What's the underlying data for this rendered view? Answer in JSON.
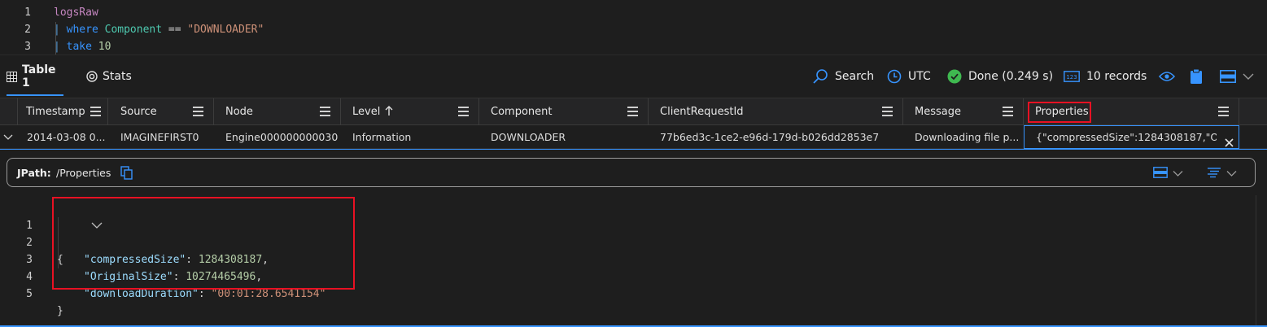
{
  "editor": {
    "lines": [
      {
        "num": "1",
        "table": "logsRaw"
      },
      {
        "num": "2",
        "pipe": "|",
        "keyword": "where",
        "column": "Component",
        "operator": "==",
        "string": "\"DOWNLOADER\""
      },
      {
        "num": "3",
        "pipe": "|",
        "keyword": "take",
        "number": "10"
      }
    ]
  },
  "toolbar": {
    "tabs": [
      {
        "label": "Table 1",
        "icon": "table-icon",
        "active": true
      },
      {
        "label": "Stats",
        "icon": "stats-icon",
        "active": false
      }
    ],
    "search_label": "Search",
    "timezone_label": "UTC",
    "status_label": "Done (0.249 s)",
    "records_label": "10 records",
    "icons": [
      "search-icon",
      "clock-icon",
      "check-circle-icon",
      "records-icon",
      "eye-icon",
      "clipboard-icon",
      "layout-icon",
      "chevron-down-icon"
    ]
  },
  "grid": {
    "columns": [
      {
        "label": "Timestamp"
      },
      {
        "label": "Source"
      },
      {
        "label": "Node"
      },
      {
        "label": "Level",
        "sort": "ascending"
      },
      {
        "label": "Component"
      },
      {
        "label": "ClientRequestId"
      },
      {
        "label": "Message"
      },
      {
        "label": "Properties",
        "highlighted": true
      }
    ],
    "rows": [
      {
        "Timestamp": "2014-03-08 0...",
        "Source": "IMAGINEFIRST0",
        "Node": "Engine000000000030",
        "Level": "Information",
        "Component": "DOWNLOADER",
        "ClientRequestId": "77b6ed3c-1ce2-e96d-179d-b026dd2853e7",
        "Message": "Downloading file p...",
        "Properties": "{\"compressedSize\":1284308187,\"Ori..."
      }
    ]
  },
  "detail": {
    "jpath_label": "JPath:",
    "jpath_value": "/Properties",
    "json_lines": [
      {
        "num": "1",
        "text": "{"
      },
      {
        "num": "2",
        "key": "\"compressedSize\"",
        "sep": ": ",
        "value": "1284308187",
        "kind": "number",
        "trail": ","
      },
      {
        "num": "3",
        "key": "\"OriginalSize\"",
        "sep": ": ",
        "value": "10274465496",
        "kind": "number",
        "trail": ","
      },
      {
        "num": "4",
        "key": "\"downloadDuration\"",
        "sep": ": ",
        "value": "\"00:01:28.6541154\"",
        "kind": "string",
        "trail": ""
      },
      {
        "num": "5",
        "text": "}"
      }
    ]
  },
  "colors": {
    "accent": "#3794ff",
    "highlight": "#e81123",
    "success": "#3fb950"
  }
}
